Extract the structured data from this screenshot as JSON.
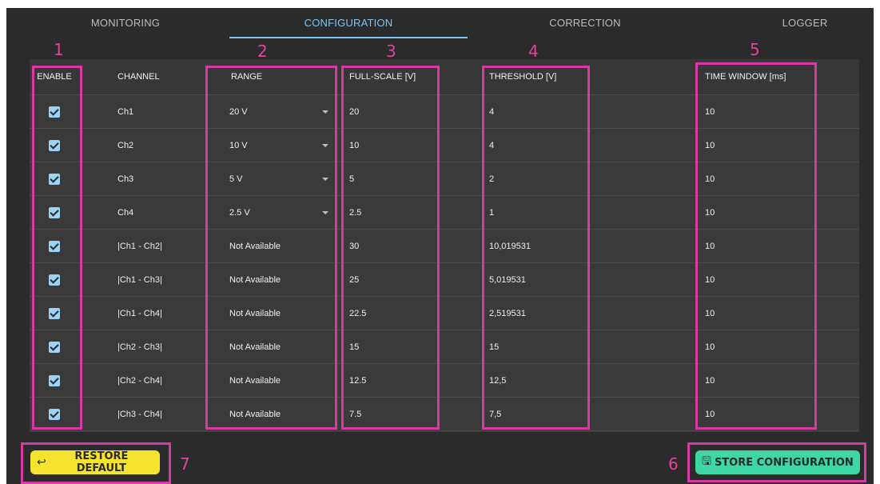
{
  "tabs": [
    {
      "label": "MONITORING"
    },
    {
      "label": "CONFIGURATION",
      "active": true
    },
    {
      "label": "CORRECTION"
    },
    {
      "label": "LOGGER"
    }
  ],
  "callouts": [
    "1",
    "2",
    "3",
    "4",
    "5",
    "6",
    "7"
  ],
  "table": {
    "headers": {
      "enable": "ENABLE",
      "channel": "CHANNEL",
      "range": "RANGE",
      "full_scale": "FULL-SCALE [V]",
      "threshold": "THRESHOLD [V]",
      "time_window": "TIME WINDOW [ms]"
    },
    "rows": [
      {
        "enabled": true,
        "channel": "Ch1",
        "range": "20 V",
        "range_select": true,
        "full_scale": "20",
        "threshold": "4",
        "time_window": "10"
      },
      {
        "enabled": true,
        "channel": "Ch2",
        "range": "10 V",
        "range_select": true,
        "full_scale": "10",
        "threshold": "4",
        "time_window": "10"
      },
      {
        "enabled": true,
        "channel": "Ch3",
        "range": "5 V",
        "range_select": true,
        "full_scale": "5",
        "threshold": "2",
        "time_window": "10"
      },
      {
        "enabled": true,
        "channel": "Ch4",
        "range": "2.5 V",
        "range_select": true,
        "full_scale": "2.5",
        "threshold": "1",
        "time_window": "10"
      },
      {
        "enabled": true,
        "channel": "|Ch1 - Ch2|",
        "range": "Not Available",
        "range_select": false,
        "full_scale": "30",
        "threshold": "10,019531",
        "time_window": "10"
      },
      {
        "enabled": true,
        "channel": "|Ch1 - Ch3|",
        "range": "Not Available",
        "range_select": false,
        "full_scale": "25",
        "threshold": "5,019531",
        "time_window": "10"
      },
      {
        "enabled": true,
        "channel": "|Ch1 - Ch4|",
        "range": "Not Available",
        "range_select": false,
        "full_scale": "22.5",
        "threshold": "2,519531",
        "time_window": "10"
      },
      {
        "enabled": true,
        "channel": "|Ch2 - Ch3|",
        "range": "Not Available",
        "range_select": false,
        "full_scale": "15",
        "threshold": "15",
        "time_window": "10"
      },
      {
        "enabled": true,
        "channel": "|Ch2 - Ch4|",
        "range": "Not Available",
        "range_select": false,
        "full_scale": "12.5",
        "threshold": "12,5",
        "time_window": "10"
      },
      {
        "enabled": true,
        "channel": "|Ch3 - Ch4|",
        "range": "Not Available",
        "range_select": false,
        "full_scale": "7.5",
        "threshold": "7,5",
        "time_window": "10"
      }
    ]
  },
  "buttons": {
    "restore_label": "RESTORE DEFAULT",
    "restore_icon": "return-arrow-icon",
    "store_label": "STORE CONFIGURATION",
    "store_icon": "floppy-disk-icon"
  },
  "colors": {
    "background": "#2b2b2b",
    "active_tab": "#7ec6f5",
    "highlight": "#d63aa3",
    "restore_button": "#f4e32f",
    "store_button": "#3fd6a6"
  }
}
